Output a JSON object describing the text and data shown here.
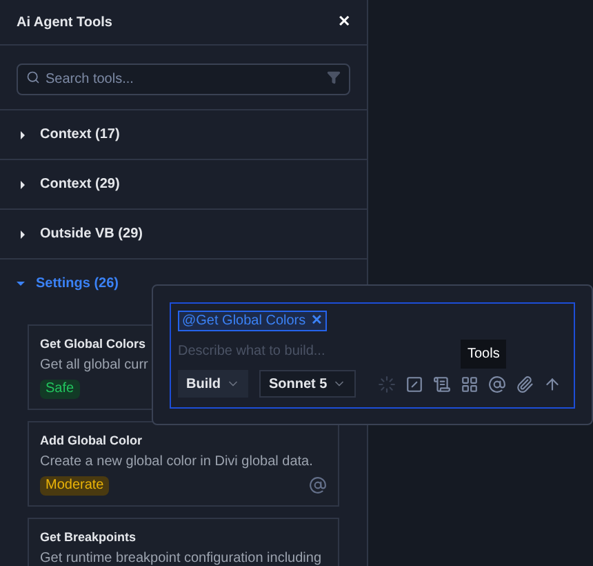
{
  "panel": {
    "title": "Ai Agent Tools",
    "close": "✕",
    "search": {
      "placeholder": "Search tools..."
    },
    "sections": [
      {
        "label": "Context (17)",
        "expanded": false
      },
      {
        "label": "Context (29)",
        "expanded": false
      },
      {
        "label": "Outside VB (29)",
        "expanded": false
      },
      {
        "label": "Settings (26)",
        "expanded": true,
        "tools": [
          {
            "title": "Get Global Colors",
            "description": "Get all global curr",
            "badge": {
              "text": "Safe",
              "kind": "safe"
            },
            "mention_button": false
          },
          {
            "title": "Add Global Color",
            "description": "Create a new global color in Divi global data.",
            "badge": {
              "text": "Moderate",
              "kind": "moderate"
            },
            "mention_button": true
          },
          {
            "title": "Get Breakpoints",
            "description": "Get runtime breakpoint configuration including",
            "mention_button": false
          }
        ]
      }
    ]
  },
  "composer": {
    "chip": {
      "text": "@Get Global Colors",
      "remove": "✕"
    },
    "placeholder": "Describe what to build...",
    "mode": "Build",
    "model": "Sonnet 5",
    "tooltip": "Tools"
  }
}
